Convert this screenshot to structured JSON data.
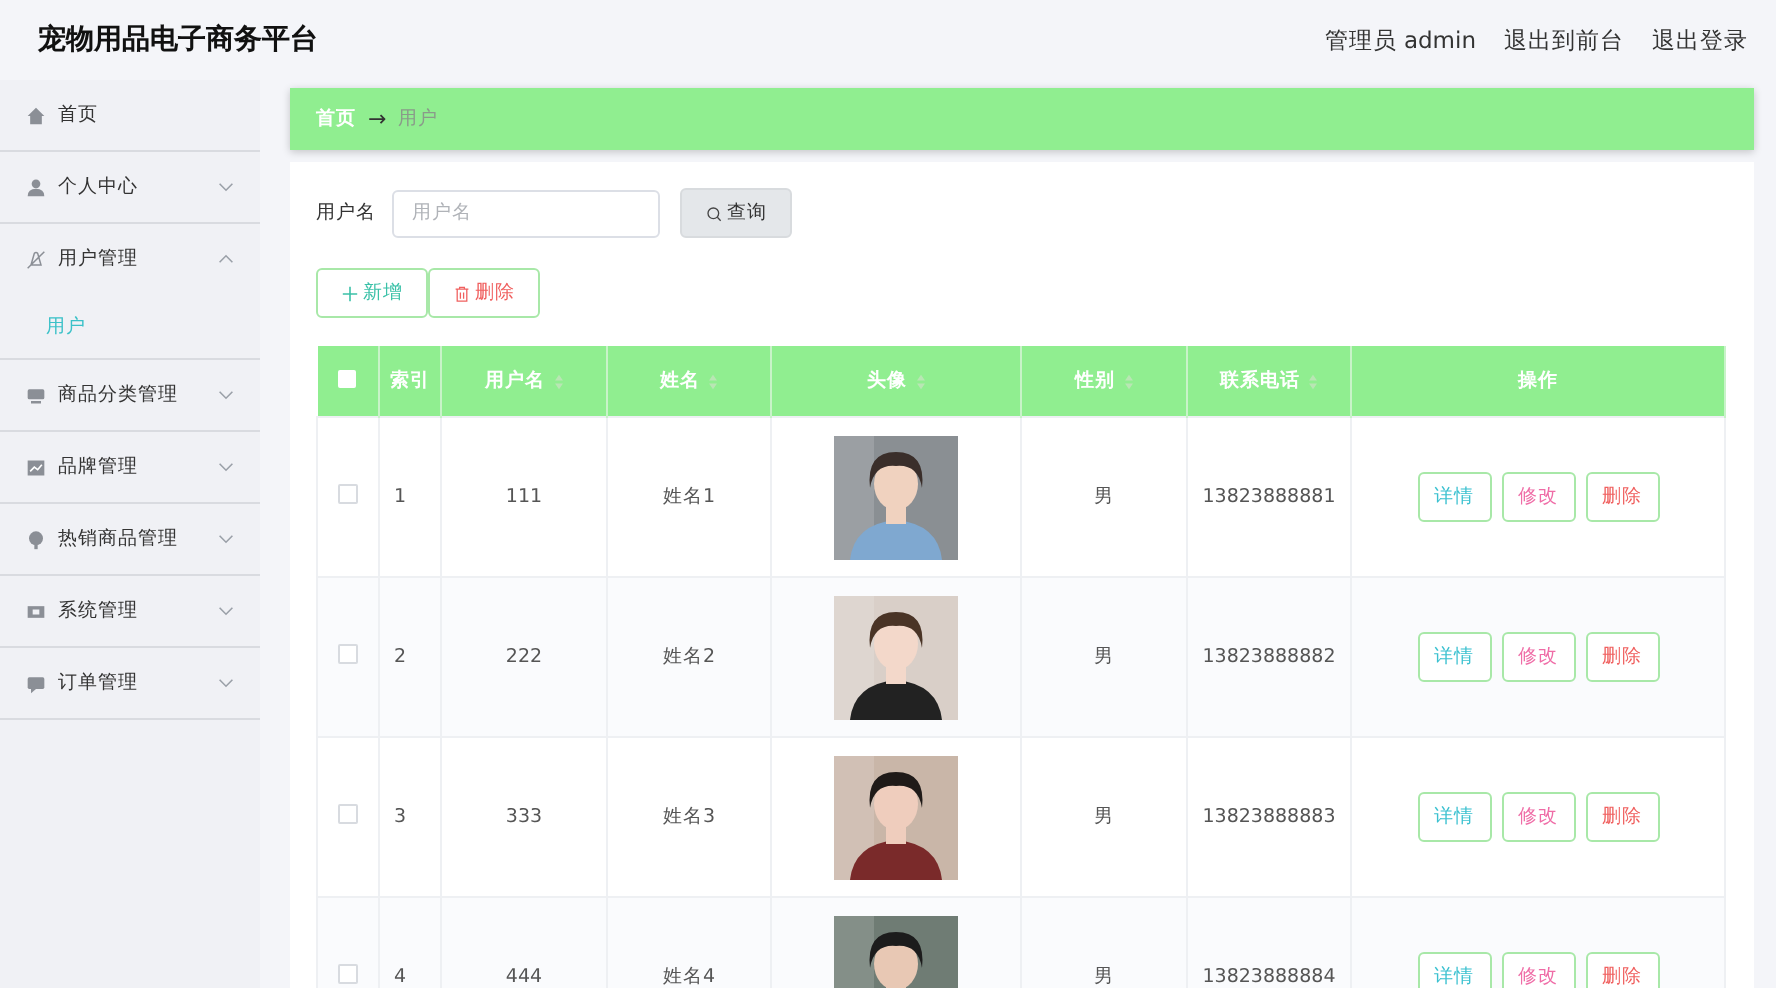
{
  "header": {
    "title": "宠物用品电子商务平台",
    "links": [
      "管理员 admin",
      "退出到前台",
      "退出登录"
    ]
  },
  "sidebar": {
    "items": [
      {
        "label": "首页",
        "expandable": false,
        "expanded": false
      },
      {
        "label": "个人中心",
        "expandable": true,
        "expanded": false
      },
      {
        "label": "用户管理",
        "expandable": true,
        "expanded": true,
        "children": [
          {
            "label": "用户",
            "selected": true
          }
        ]
      },
      {
        "label": "商品分类管理",
        "expandable": true,
        "expanded": false
      },
      {
        "label": "品牌管理",
        "expandable": true,
        "expanded": false
      },
      {
        "label": "热销商品管理",
        "expandable": true,
        "expanded": false
      },
      {
        "label": "系统管理",
        "expandable": true,
        "expanded": false
      },
      {
        "label": "订单管理",
        "expandable": true,
        "expanded": false
      }
    ]
  },
  "breadcrumb": {
    "items": [
      "首页",
      "用户"
    ],
    "separator": "→"
  },
  "search": {
    "label": "用户名",
    "placeholder": "用户名",
    "button": "查询"
  },
  "toolbar": [
    {
      "label": "新增",
      "kind": "add"
    },
    {
      "label": "删除",
      "kind": "delete"
    }
  ],
  "table": {
    "all_checked": false,
    "columns": [
      {
        "label": "索引",
        "sortable": false
      },
      {
        "label": "用户名",
        "sortable": true
      },
      {
        "label": "姓名",
        "sortable": true
      },
      {
        "label": "头像",
        "sortable": true
      },
      {
        "label": "性别",
        "sortable": true
      },
      {
        "label": "联系电话",
        "sortable": true
      },
      {
        "label": "操作",
        "sortable": false
      }
    ],
    "rows": [
      {
        "checked": false,
        "index": "1",
        "username": "111",
        "name": "姓名1",
        "avatar": {
          "kind": "picture"
        },
        "gender": "男",
        "phone": "13823888881",
        "actions": [
          {
            "label": "详情",
            "kind": "detail"
          },
          {
            "label": "修改",
            "kind": "edit"
          },
          {
            "label": "删除",
            "kind": "delete"
          }
        ]
      },
      {
        "checked": false,
        "index": "2",
        "username": "222",
        "name": "姓名2",
        "avatar": {
          "kind": "picture"
        },
        "gender": "男",
        "phone": "13823888882",
        "actions": [
          {
            "label": "详情",
            "kind": "detail"
          },
          {
            "label": "修改",
            "kind": "edit"
          },
          {
            "label": "删除",
            "kind": "delete"
          }
        ]
      },
      {
        "checked": false,
        "index": "3",
        "username": "333",
        "name": "姓名3",
        "avatar": {
          "kind": "picture"
        },
        "gender": "男",
        "phone": "13823888883",
        "actions": [
          {
            "label": "详情",
            "kind": "detail"
          },
          {
            "label": "修改",
            "kind": "edit"
          },
          {
            "label": "删除",
            "kind": "delete"
          }
        ]
      },
      {
        "checked": false,
        "index": "4",
        "username": "444",
        "name": "姓名4",
        "avatar": {
          "kind": "picture"
        },
        "gender": "男",
        "phone": "13823888884",
        "actions": [
          {
            "label": "详情",
            "kind": "detail"
          },
          {
            "label": "修改",
            "kind": "edit"
          },
          {
            "label": "删除",
            "kind": "delete"
          }
        ]
      }
    ]
  }
}
